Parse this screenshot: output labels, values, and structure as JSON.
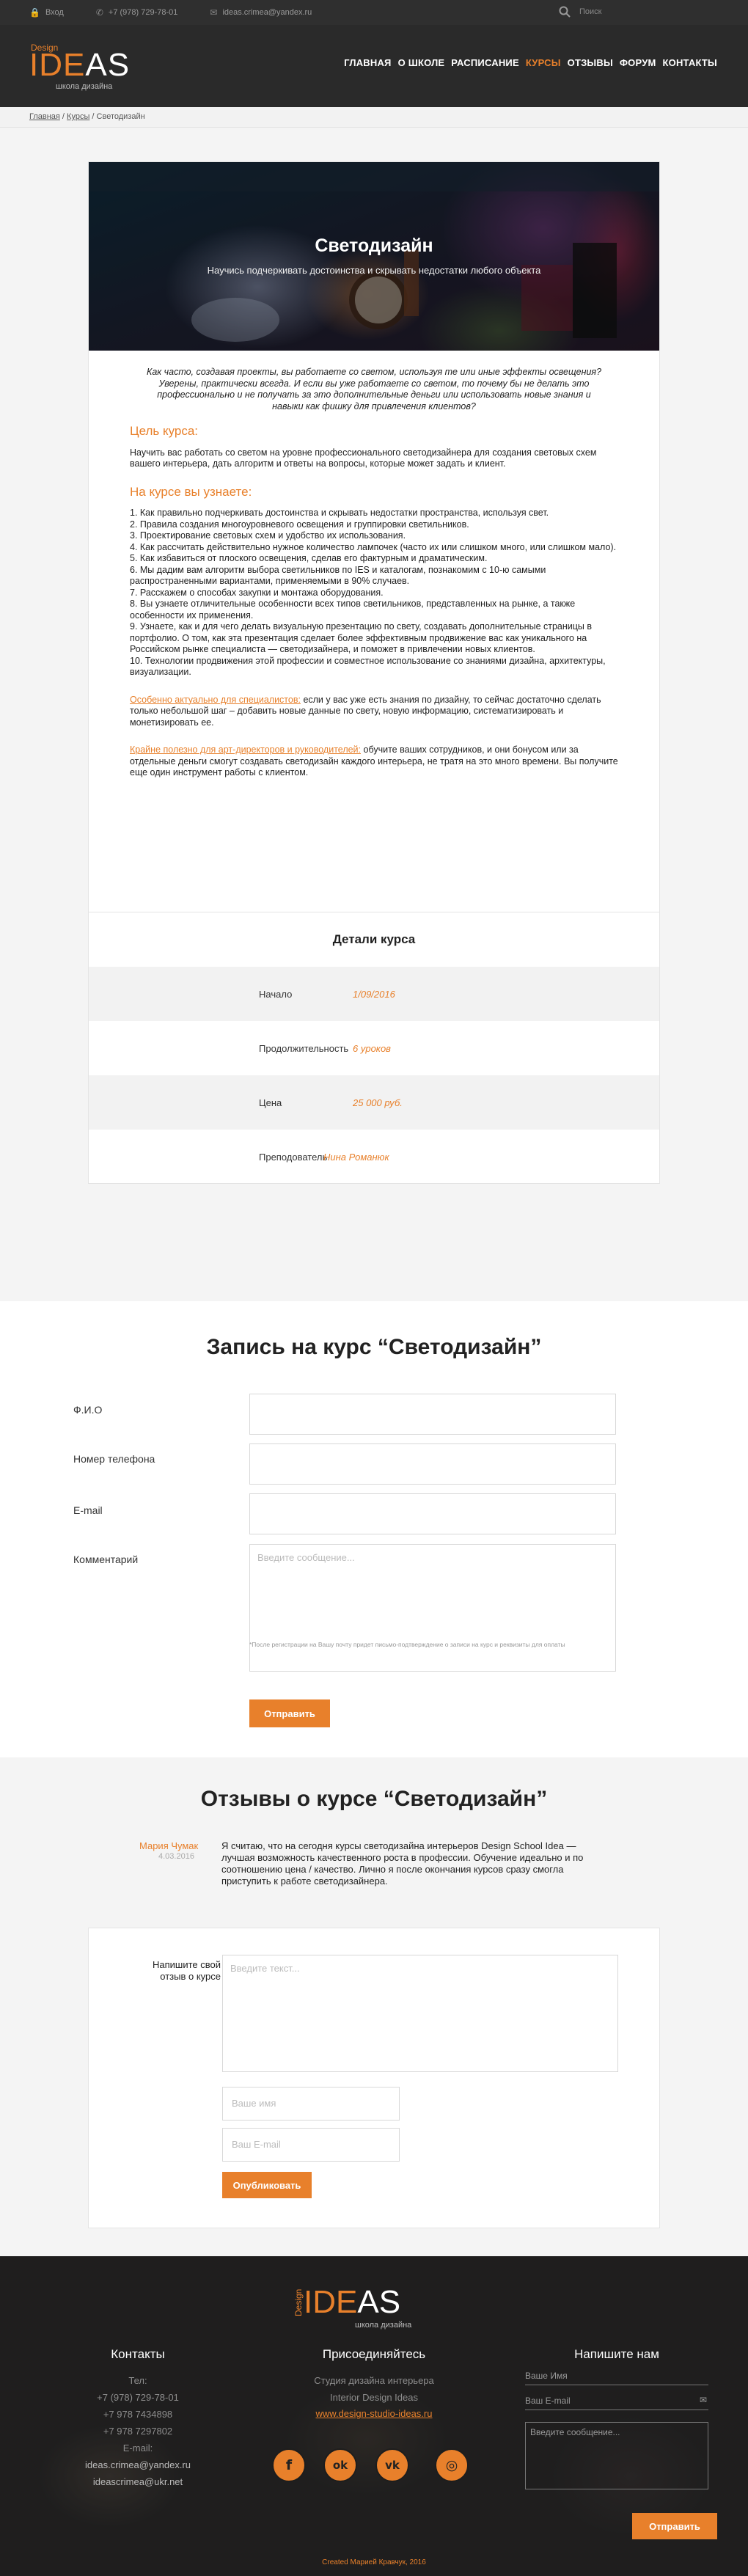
{
  "topbar": {
    "login": "Вход",
    "phone": "+7 (978) 729-78-01",
    "email": "ideas.crimea@yandex.ru",
    "search_placeholder": "Поиск"
  },
  "logo": {
    "design": "Design",
    "ideas_a": "IDE",
    "ideas_b": "AS",
    "sub": "школа дизайна"
  },
  "nav": [
    "ГЛАВНАЯ",
    "О ШКОЛЕ",
    "РАСПИСАНИЕ",
    "КУРСЫ",
    "ОТЗЫВЫ",
    "ФОРУМ",
    "КОНТАКТЫ"
  ],
  "nav_active": "КУРСЫ",
  "breadcrumb": {
    "home": "Главная",
    "sep1": " / ",
    "courses": "Курсы",
    "sep2": " / ",
    "current": "Светодизайн"
  },
  "course": {
    "title": "Светодизайн",
    "subtitle": "Научись подчеркивать достоинства и скрывать недостатки любого объекта",
    "intro": "Как часто, создавая проекты, вы работаете со светом, используя те или иные эффекты освещения? Уверены, практически всегда. И если вы уже работаете со светом, то почему бы не делать это профессионально и не получать за это дополнительные деньги или использовать новые знания и навыки как фишку для привлечения клиентов?",
    "goal_heading": "Цель курса:",
    "goal_text": "Научить вас работать со светом на уровне профессионального светодизайнера для создания световых схем вашего интерьера, дать алгоритм и ответы на вопросы, которые может задать и клиент.",
    "learn_heading": "На курсе вы узнаете:",
    "learn_items": [
      "1. Как правильно подчеркивать достоинства и скрывать недостатки пространства, используя свет.",
      "2. Правила создания многоуровневого освещения и группировки светильников.",
      "3. Проектирование световых схем и удобство их использования.",
      "4. Как рассчитать действительно нужное количество лампочек (часто их или слишком много, или слишком мало).",
      "5. Как избавиться от плоского освещения, сделав его фактурным и драматическим.",
      "6. Мы дадим вам алгоритм выбора светильников по IES и каталогам, познакомим с 10-ю самыми распространенными вариантами, применяемыми в 90% случаев.",
      "7. Расскажем о способах закупки и монтажа оборудования.",
      "8. Вы узнаете отличительные особенности всех типов светильников, представленных на рынке, а также особенности их применения.",
      "9. Узнаете, как и для чего делать визуальную презентацию по свету, создавать дополнительные страницы в портфолио.  О том, как эта презентация сделает более эффективным продвижение вас как уникального на Российском рынке специалиста — светодизайнера, и поможет в привлечении новых клиентов.",
      "10. Технологии продвижения этой профессии и совместное использование со знаниями дизайна, архитектуры, визуализации."
    ],
    "spec_link": "Особенно актуально для специалистов:",
    "spec_text": " если у вас уже есть знания по дизайну, то сейчас достаточно сделать только небольшой шаг – добавить новые данные по свету, новую информацию, систематизировать и монетизировать ее.",
    "art_link": "Крайне полезно для арт-директоров и руководителей:",
    "art_text": " обучите ваших сотрудников, и они бонусом или за отдельные деньги смогут создавать светодизайн каждого интерьера, не тратя на это много времени. Вы получите еще один инструмент работы с клиентом."
  },
  "details": {
    "title": "Детали курса",
    "rows": [
      {
        "key": "Начало",
        "value": "1/09/2016"
      },
      {
        "key": "Продолжительность",
        "value": "6 уроков"
      },
      {
        "key": "Цена",
        "value": "25 000 руб."
      },
      {
        "key": "Преподователь",
        "value": "Нина Романюк"
      }
    ]
  },
  "signup": {
    "title": "Запись на курс “Светодизайн”",
    "name_label": "Ф.И.О",
    "phone_label": "Номер телефона",
    "email_label": "E-mail",
    "comment_label": "Комментарий",
    "comment_placeholder": "Введите сообщение...",
    "note": "*После регистрации на Вашу почту придет письмо-подтверждение о записи на курс и реквизиты для оплаты",
    "submit": "Отправить"
  },
  "reviews": {
    "title": "Отзывы о курсе “Светодизайн”",
    "items": [
      {
        "name": "Мария Чумак",
        "date": "4.03.2016",
        "text": "Я считаю, что на сегодня курсы светодизайна интерьеров Design School Idea — лучшая возможность качественного роста в профессии. Обучение идеально и по соотношению цена / качество. Лично я после окончания курсов сразу смогла приступить к работе светодизайнера."
      }
    ],
    "form_label": "Напишите свой отзыв о курсе",
    "text_placeholder": "Введите текст...",
    "name_placeholder": "Ваше имя",
    "email_placeholder": "Ваш E-mail",
    "submit": "Опубликовать"
  },
  "footer": {
    "logo": {
      "design": "Design",
      "ideas_a": "IDE",
      "ideas_b": "AS",
      "sub": "школа дизайна"
    },
    "contacts": {
      "title": "Контакты",
      "tel_label": "Тел:",
      "phones": [
        "+7 (978) 729-78-01",
        "+7 978 7434898",
        "+7 978 7297802"
      ],
      "email_label": "E-mail:",
      "emails": [
        "ideas.crimea@yandex.ru",
        "ideascrimea@ukr.net"
      ]
    },
    "join": {
      "title": "Присоединяйтесь",
      "line1": "Студия дизайна интерьера",
      "line2": "Interior Design Ideas",
      "link": "www.design-studio-ideas.ru"
    },
    "social_icons": [
      "facebook-icon",
      "odnoklassniki-icon",
      "vk-icon",
      "instagram-icon"
    ],
    "social_glyphs": [
      "f",
      "ok",
      "vk",
      "◎"
    ],
    "write": {
      "title": "Напишите нам",
      "name_placeholder": "Ваше Имя",
      "email_placeholder": "Ваш E-mail",
      "message_placeholder": "Введите сообщение...",
      "submit": "Отправить"
    },
    "copyright": "Created Марией Кравчук, 2016"
  },
  "colors": {
    "accent": "#e8802b",
    "dark": "#2a2a2a",
    "light_bg": "#f4f4f4"
  }
}
